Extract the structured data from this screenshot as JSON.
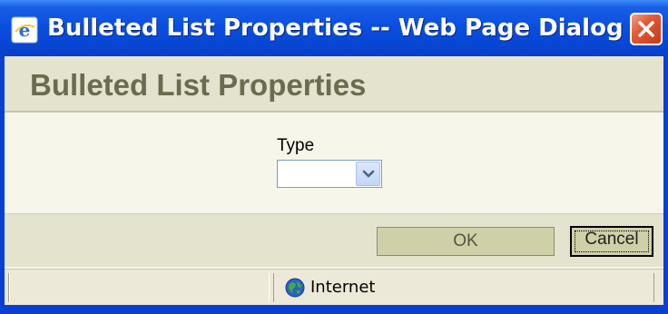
{
  "window": {
    "title": "Bulleted List Properties -- Web Page Dialog",
    "icons": {
      "app": "ie-icon",
      "close": "close-icon"
    }
  },
  "dialog": {
    "heading": "Bulleted List Properties",
    "type_label": "Type",
    "type_value": "",
    "ok_label": "OK",
    "cancel_label": "Cancel"
  },
  "statusbar": {
    "left_text": "",
    "zone": "Internet",
    "zone_icon": "globe-icon"
  },
  "colors": {
    "titlebar": "#0a4fe0",
    "client": "#f6f6ea",
    "band": "#e3e3ce",
    "heading_text": "#6b6b50",
    "button": "#cfcfa8",
    "close": "#e05a36"
  }
}
